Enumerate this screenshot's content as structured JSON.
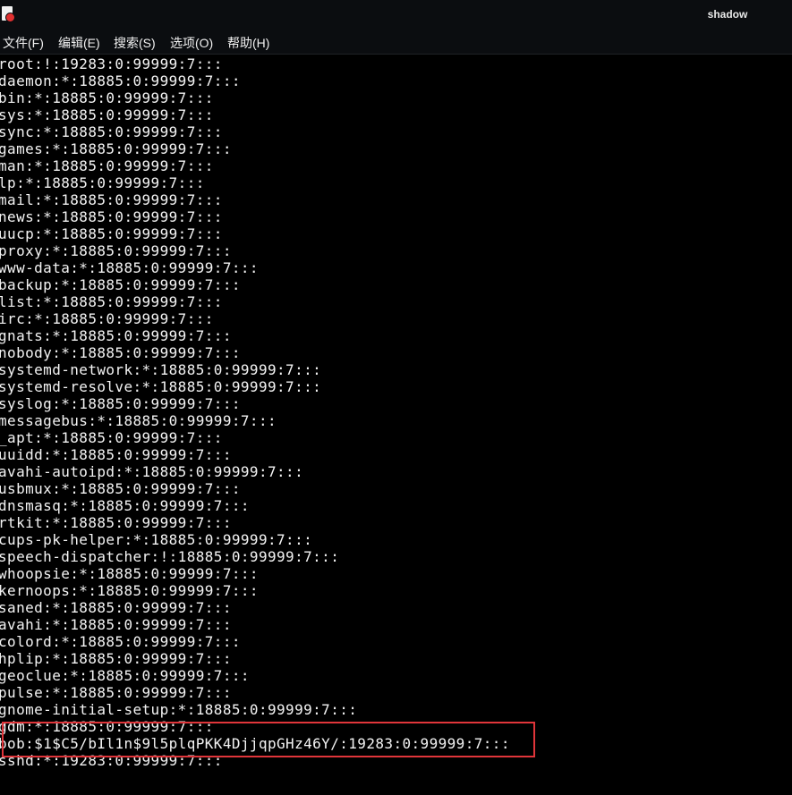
{
  "window": {
    "title": "shadow",
    "app_icon": "text-editor-icon"
  },
  "menu": {
    "items": [
      {
        "name": "menu-file",
        "label": "文件(F)"
      },
      {
        "name": "menu-edit",
        "label": "编辑(E)"
      },
      {
        "name": "menu-search",
        "label": "搜索(S)"
      },
      {
        "name": "menu-options",
        "label": "选项(O)"
      },
      {
        "name": "menu-help",
        "label": "帮助(H)"
      }
    ]
  },
  "editor": {
    "lines": [
      "root:!:19283:0:99999:7:::",
      "daemon:*:18885:0:99999:7:::",
      "bin:*:18885:0:99999:7:::",
      "sys:*:18885:0:99999:7:::",
      "sync:*:18885:0:99999:7:::",
      "games:*:18885:0:99999:7:::",
      "man:*:18885:0:99999:7:::",
      "lp:*:18885:0:99999:7:::",
      "mail:*:18885:0:99999:7:::",
      "news:*:18885:0:99999:7:::",
      "uucp:*:18885:0:99999:7:::",
      "proxy:*:18885:0:99999:7:::",
      "www-data:*:18885:0:99999:7:::",
      "backup:*:18885:0:99999:7:::",
      "list:*:18885:0:99999:7:::",
      "irc:*:18885:0:99999:7:::",
      "gnats:*:18885:0:99999:7:::",
      "nobody:*:18885:0:99999:7:::",
      "systemd-network:*:18885:0:99999:7:::",
      "systemd-resolve:*:18885:0:99999:7:::",
      "syslog:*:18885:0:99999:7:::",
      "messagebus:*:18885:0:99999:7:::",
      "_apt:*:18885:0:99999:7:::",
      "uuidd:*:18885:0:99999:7:::",
      "avahi-autoipd:*:18885:0:99999:7:::",
      "usbmux:*:18885:0:99999:7:::",
      "dnsmasq:*:18885:0:99999:7:::",
      "rtkit:*:18885:0:99999:7:::",
      "cups-pk-helper:*:18885:0:99999:7:::",
      "speech-dispatcher:!:18885:0:99999:7:::",
      "whoopsie:*:18885:0:99999:7:::",
      "kernoops:*:18885:0:99999:7:::",
      "saned:*:18885:0:99999:7:::",
      "avahi:*:18885:0:99999:7:::",
      "colord:*:18885:0:99999:7:::",
      "hplip:*:18885:0:99999:7:::",
      "geoclue:*:18885:0:99999:7:::",
      "pulse:*:18885:0:99999:7:::",
      "gnome-initial-setup:*:18885:0:99999:7:::",
      "gdm:*:18885:0:99999:7:::",
      "bob:$1$C5/bIl1n$9l5plqPKK4DjjqpGHz46Y/:19283:0:99999:7:::",
      "sshd:*:19283:0:99999:7:::"
    ],
    "highlight_color": "#e0353a"
  }
}
